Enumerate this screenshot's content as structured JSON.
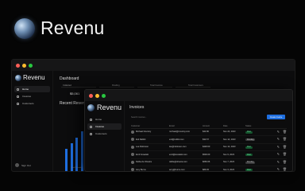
{
  "brand": {
    "name": "Revenu"
  },
  "colors": {
    "accent": "#1f6fe0",
    "paid_bg": "#14532d",
    "paid_fg": "#6ee7a0",
    "window_bg": "#0c0c0d"
  },
  "dashboard_window": {
    "sidebar": {
      "brand": "Revenu",
      "items": [
        {
          "label": "Home",
          "icon": "home-icon"
        },
        {
          "label": "Invoices",
          "icon": "invoice-icon"
        },
        {
          "label": "Customers",
          "icon": "users-icon"
        }
      ],
      "user": "Sign Out"
    },
    "title": "Dashboard",
    "stats": [
      {
        "label": "Collected"
      },
      {
        "label": "Pending"
      },
      {
        "label": "Total Invoices"
      },
      {
        "label": "Total Customers"
      }
    ],
    "first_value": "$5,061",
    "recent_title": "Recent Revenue",
    "legend": "Last 12 months"
  },
  "chart_data": {
    "type": "bar",
    "values": [
      28,
      35,
      42,
      50,
      58,
      66
    ],
    "ylim": [
      0,
      70
    ]
  },
  "invoices_window": {
    "sidebar": {
      "brand": "Revenu",
      "items": [
        {
          "label": "Home",
          "icon": "home-icon"
        },
        {
          "label": "Invoices",
          "icon": "invoice-icon"
        },
        {
          "label": "Customers",
          "icon": "users-icon"
        }
      ]
    },
    "title": "Invoices",
    "search_placeholder": "Search invoices...",
    "create_label": "Create Invoice",
    "columns": [
      "Customer",
      "Email",
      "Amount",
      "Date",
      "Status"
    ],
    "rows": [
      {
        "customer": "Michael Novotny",
        "email": "michael@novotny.com",
        "amount": "$44.80",
        "date": "Nov 24, 2023",
        "status": "Paid"
      },
      {
        "customer": "Evil Rabbit",
        "email": "evil@rabbit.com",
        "amount": "$34.57",
        "date": "Nov 14, 2023",
        "status": "Pending"
      },
      {
        "customer": "Lee Robinson",
        "email": "lee@robinson.com",
        "amount": "$448.00",
        "date": "Nov 12, 2023",
        "status": "Paid"
      },
      {
        "customer": "Emil Kowalski",
        "email": "emil@kowalski.com",
        "amount": "$500.00",
        "date": "Nov 9, 2023",
        "status": "Paid"
      },
      {
        "customer": "Delba de Oliveira",
        "email": "delba@oliveira.com",
        "amount": "$666.66",
        "date": "Nov 7, 2023",
        "status": "Pending"
      },
      {
        "customer": "Amy Burns",
        "email": "amy@burns.com",
        "amount": "$89.45",
        "date": "Nov 3, 2023",
        "status": "Paid"
      },
      {
        "customer": "Lee Robinson",
        "email": "lee@robinson.com",
        "amount": "$32.45",
        "date": "Nov 1, 2023",
        "status": "Paid"
      }
    ]
  }
}
